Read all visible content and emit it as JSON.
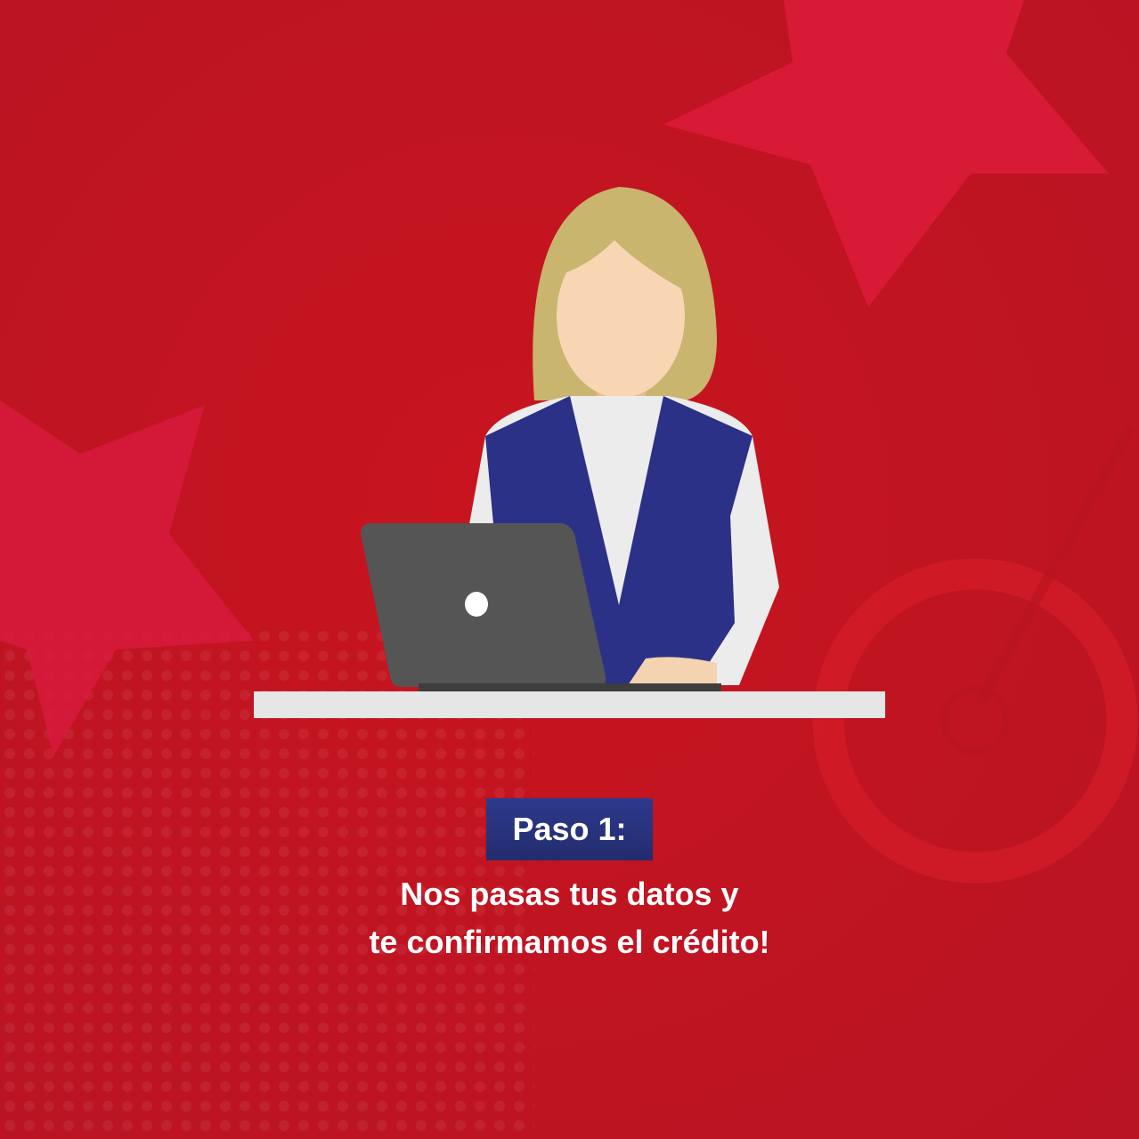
{
  "step": {
    "label": "Paso 1:"
  },
  "message": {
    "line1": "Nos pasas tus datos y",
    "line2": "te confirmamos el crédito!"
  },
  "colors": {
    "background": "#c41624",
    "badge": "#2a3580",
    "vest": "#2b3187",
    "hair": "#c9b56e",
    "laptop": "#555555",
    "desk": "#e6e6e6"
  }
}
